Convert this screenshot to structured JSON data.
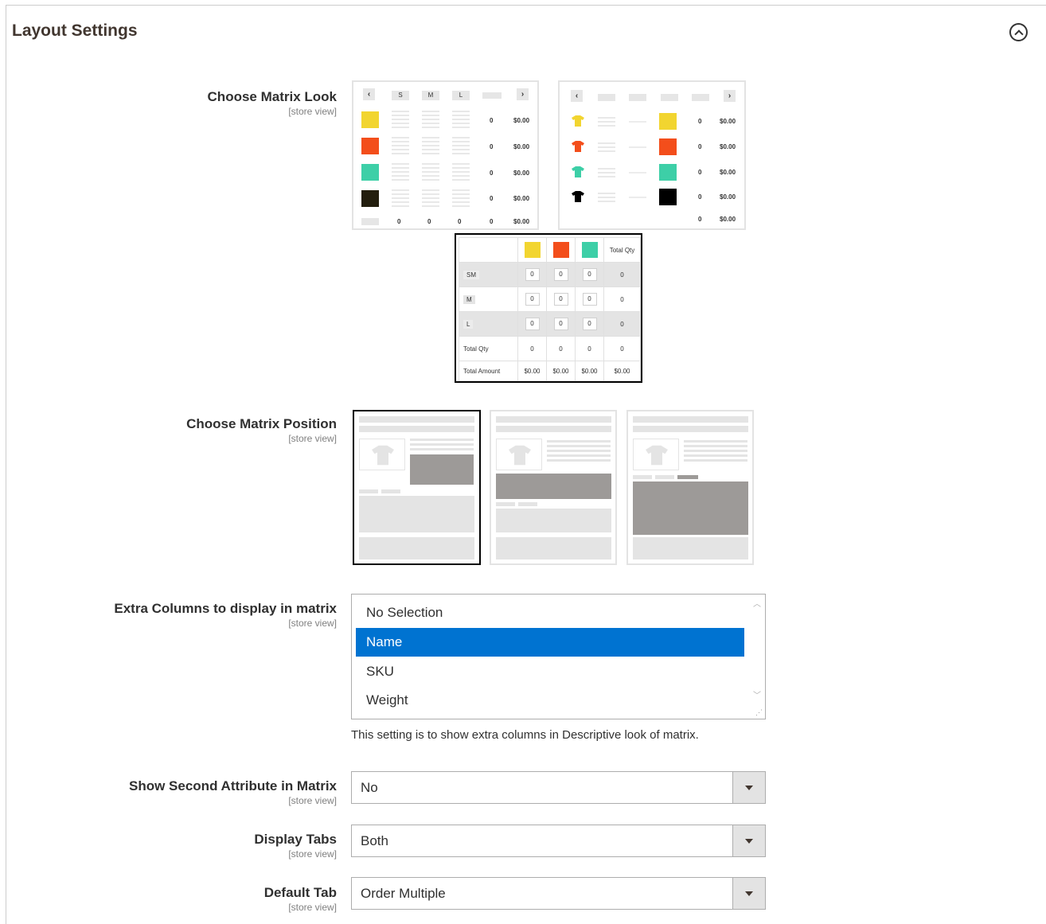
{
  "section": {
    "title": "Layout Settings"
  },
  "scope_label": "[store view]",
  "fields": {
    "matrix_look": {
      "label": "Choose Matrix Look"
    },
    "matrix_position": {
      "label": "Choose Matrix Position"
    },
    "extra_columns": {
      "label": "Extra Columns to display in matrix",
      "options": [
        "No Selection",
        "Name",
        "SKU",
        "Weight"
      ],
      "selected": "Name",
      "note": "This setting is to show extra columns in Descriptive look of matrix."
    },
    "second_attribute": {
      "label": "Show Second Attribute in Matrix",
      "value": "No"
    },
    "display_tabs": {
      "label": "Display Tabs",
      "value": "Both"
    },
    "default_tab": {
      "label": "Default Tab",
      "value": "Order Multiple"
    }
  },
  "preview_simple": {
    "sizes": [
      "S",
      "M",
      "L"
    ],
    "qty": "0",
    "price": "$0.00",
    "swatch_colors": [
      "#f2d530",
      "#f34e1b",
      "#3dcfa7",
      "#231e0e"
    ]
  },
  "preview_descriptive": {
    "qty": "0",
    "price": "$0.00",
    "swatch_colors": [
      "#f2d530",
      "#f34e1b",
      "#3dcfa7",
      "#000000"
    ]
  },
  "preview_grid": {
    "total_qty_label": "Total Qty",
    "total_amount_label": "Total Amount",
    "rows": [
      "SM",
      "M",
      "L"
    ],
    "cell": "0",
    "amount": "$0.00",
    "swatch_colors": [
      "#f2d530",
      "#f34e1b",
      "#3dcfa7"
    ]
  },
  "icons": {
    "collapse": "chevron-up-circle-icon",
    "dropdown": "chevron-down-icon",
    "shirt": "tshirt-icon"
  }
}
